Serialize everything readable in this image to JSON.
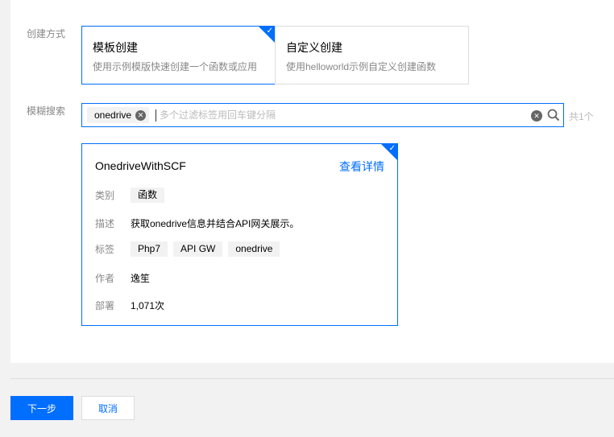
{
  "create_mode": {
    "label": "创建方式",
    "options": [
      {
        "title": "模板创建",
        "desc": "使用示例模版快速创建一个函数或应用",
        "selected": true
      },
      {
        "title": "自定义创建",
        "desc": "使用helloworld示例自定义创建函数",
        "selected": false
      }
    ]
  },
  "search": {
    "label": "模糊搜索",
    "tag": "onedrive",
    "placeholder": "多个过滤标签用回车键分隔",
    "count": "共1个"
  },
  "result": {
    "name": "OnedriveWithSCF",
    "detail_link": "查看详情",
    "category_label": "类别",
    "category": "函数",
    "desc_label": "描述",
    "desc": "获取onedrive信息并结合API网关展示。",
    "tags_label": "标签",
    "tags": [
      "Php7",
      "API GW",
      "onedrive"
    ],
    "author_label": "作者",
    "author": "逸笙",
    "deploy_label": "部署",
    "deploy_count": "1,071次"
  },
  "footer": {
    "next_label": "下一步",
    "cancel_label": "取消"
  },
  "colors": {
    "accent": "#006eff"
  }
}
